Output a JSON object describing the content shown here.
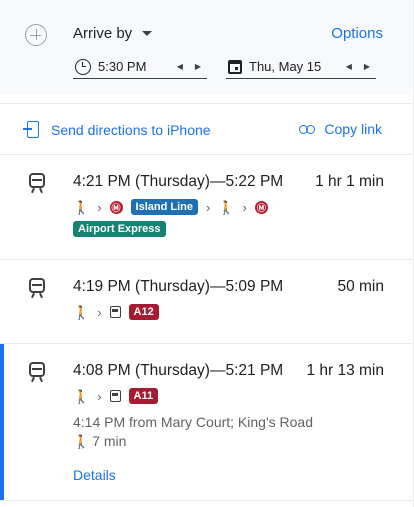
{
  "header": {
    "add_icon": "add-destination-icon",
    "mode_label": "Arrive by",
    "options_label": "Options",
    "time_value": "5:30 PM",
    "date_value": "Thu, May 15",
    "prev_glyph": "‹",
    "next_glyph": "›"
  },
  "actions": {
    "send_label": "Send directions to iPhone",
    "copy_label": "Copy link"
  },
  "routes": [
    {
      "times": "4:21 PM (Thursday)—5:22 PM",
      "duration": "1 hr 1 min",
      "badges": [
        "Island Line",
        "Airport Express"
      ]
    },
    {
      "times": "4:19 PM (Thursday)—5:09 PM",
      "duration": "50 min",
      "badges": [
        "A12"
      ]
    },
    {
      "times": "4:08 PM (Thursday)—5:21 PM",
      "duration": "1 hr 13 min",
      "badges": [
        "A11"
      ],
      "departure": "4:14 PM from Mary Court; King's Road",
      "walk": "7 min",
      "details_label": "Details"
    }
  ],
  "glyphs": {
    "walk": "🚶",
    "chevron": "›",
    "mtr": "Ⓜ"
  },
  "colors": {
    "accent": "#1a73e8",
    "island_line": "#1f6fb5",
    "airport_express": "#15836e",
    "bus": "#a51c30",
    "mtr": "#ba1a2e"
  }
}
